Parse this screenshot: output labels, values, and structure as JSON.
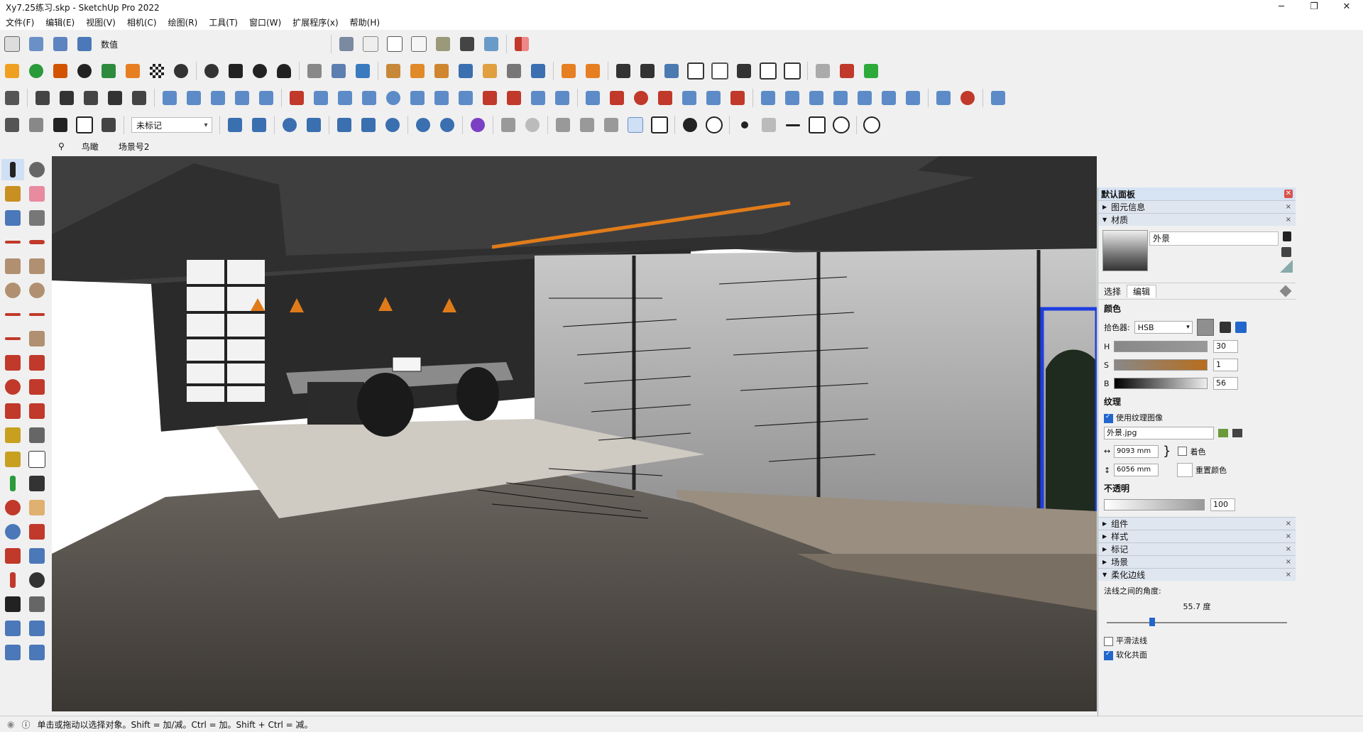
{
  "window": {
    "title": "Xy7.25练习.skp - SketchUp Pro 2022"
  },
  "menu": [
    "文件(F)",
    "编辑(E)",
    "视图(V)",
    "相机(C)",
    "绘图(R)",
    "工具(T)",
    "窗口(W)",
    "扩展程序(x)",
    "帮助(H)"
  ],
  "toolbar": {
    "value_label": "数值",
    "tag_select": "未标记"
  },
  "scene_tabs": [
    "鸟瞰",
    "场景号2"
  ],
  "status": {
    "text": "单击或拖动以选择对象。Shift = 加/减。Ctrl = 加。Shift + Ctrl = 减。"
  },
  "panel": {
    "title": "默认面板",
    "sections_top": [
      "图元信息",
      "材质"
    ],
    "material": {
      "name": "外景",
      "tab_select": "选择",
      "tab_edit": "编辑",
      "color_label": "颜色",
      "picker_label": "拾色器:",
      "picker_value": "HSB",
      "h_label": "H",
      "h_value": "30",
      "s_label": "S",
      "s_value": "1",
      "b_label": "B",
      "b_value": "56",
      "texture_label": "纹理",
      "use_texture": "使用纹理图像",
      "texture_file": "外景.jpg",
      "width": "9093 mm",
      "height": "6056 mm",
      "colorize": "着色",
      "reset_color": "重置颜色",
      "opacity_label": "不透明",
      "opacity_value": "100"
    },
    "sections_bottom": [
      "组件",
      "样式",
      "标记",
      "场景",
      "柔化边线"
    ],
    "soften": {
      "angle_label": "法线之间的角度:",
      "angle_value": "55.7 度",
      "smooth_normals": "平滑法线",
      "soften_coplanar": "软化共面"
    }
  },
  "colors": {
    "accent": "#2266cc",
    "orange": "#e07b1a"
  }
}
